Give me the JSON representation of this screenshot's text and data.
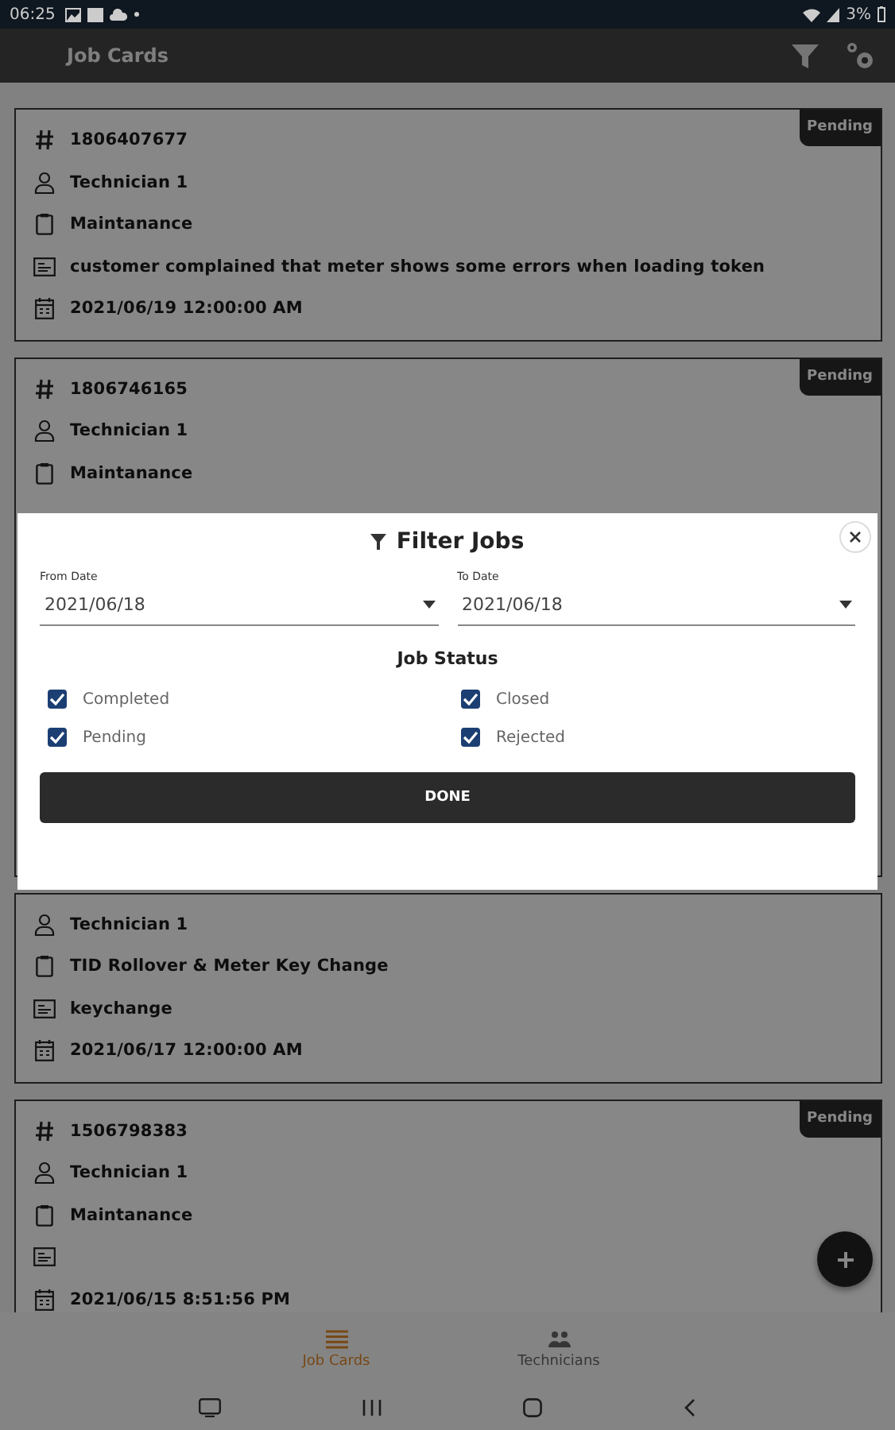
{
  "status_bar": {
    "time": "06:25",
    "battery": "3%"
  },
  "app_bar": {
    "title": "Job Cards"
  },
  "job_cards": [
    {
      "status": "Pending",
      "rows": [
        {
          "kind": "id",
          "text": "1806407677"
        },
        {
          "kind": "technician",
          "text": "Technician 1"
        },
        {
          "kind": "type",
          "text": "Maintanance"
        },
        {
          "kind": "description",
          "text": "customer complained that meter shows some errors when loading token"
        },
        {
          "kind": "date",
          "text": "2021/06/19 12:00:00 AM"
        }
      ]
    },
    {
      "status": "Pending",
      "rows": [
        {
          "kind": "id",
          "text": "1806746165"
        },
        {
          "kind": "technician",
          "text": "Technician 1"
        },
        {
          "kind": "type",
          "text": "Maintanance"
        }
      ]
    },
    {
      "rows": [
        {
          "kind": "technician",
          "text": "Technician 1"
        },
        {
          "kind": "type",
          "text": "TID Rollover & Meter Key Change"
        },
        {
          "kind": "description",
          "text": "keychange"
        },
        {
          "kind": "date",
          "text": "2021/06/17 12:00:00 AM"
        }
      ]
    },
    {
      "status": "Pending",
      "rows": [
        {
          "kind": "id",
          "text": "1506798383"
        },
        {
          "kind": "technician",
          "text": "Technician 1"
        },
        {
          "kind": "type",
          "text": "Maintanance"
        },
        {
          "kind": "description"
        },
        {
          "kind": "date",
          "text": "2021/06/15 8:51:56 PM"
        }
      ]
    }
  ],
  "bottom_nav": [
    {
      "label": "Job Cards",
      "selected": true
    },
    {
      "label": "Technicians",
      "selected": false
    }
  ],
  "filter_dialog": {
    "title": "Filter Jobs",
    "from_date": {
      "label": "From Date",
      "value": "2021/06/18"
    },
    "to_date": {
      "label": "To Date",
      "value": "2021/06/18"
    },
    "status_heading": "Job Status",
    "statuses": [
      {
        "label": "Completed",
        "checked": true
      },
      {
        "label": "Closed",
        "checked": true
      },
      {
        "label": "Pending",
        "checked": true
      },
      {
        "label": "Rejected",
        "checked": true
      }
    ],
    "done_button": "DONE"
  }
}
